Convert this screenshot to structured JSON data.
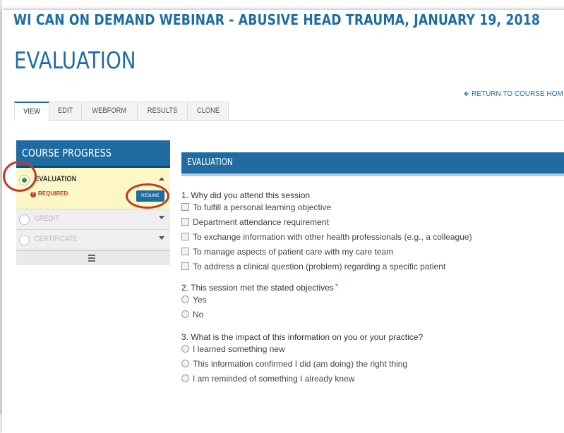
{
  "header": {
    "course_title": "WI CAN ON DEMAND WEBINAR - ABUSIVE HEAD TRAUMA, JANUARY 19, 2018",
    "page_title": "EVALUATION",
    "return_link": "RETURN TO COURSE HOM"
  },
  "tabs": [
    {
      "label": "VIEW",
      "active": true
    },
    {
      "label": "EDIT"
    },
    {
      "label": "WEBFORM"
    },
    {
      "label": "RESULTS"
    },
    {
      "label": "CLONE"
    }
  ],
  "course_progress": {
    "title": "COURSE PROGRESS",
    "steps": [
      {
        "name": "EVALUATION",
        "status": "REQUIRED",
        "action": "RESUME"
      },
      {
        "name": "CREDIT"
      },
      {
        "name": "CERTIFICATE"
      }
    ]
  },
  "evaluation": {
    "header": "EVALUATION",
    "questions": [
      {
        "text": "1. Why did you attend this session",
        "type": "checkbox",
        "options": [
          "To fulfill a personal learning objective",
          "Department attendance requirement",
          "To exchange information with other health professionals (e.g., a colleague)",
          "To manage aspects of patient care with my care team",
          "To address a clinical question (problem) regarding a specific patient"
        ]
      },
      {
        "text": "2. This session met the stated objectives",
        "required_mark": "*",
        "type": "radio",
        "options": [
          "Yes",
          "No"
        ]
      },
      {
        "text": "3. What is the impact of this information on you or your practice?",
        "type": "radio",
        "options": [
          "I learned something new",
          "This information confirmed I did (am doing) the right thing",
          "I am reminded of something I already knew"
        ]
      }
    ]
  },
  "colors": {
    "brand_blue": "#1f6ca3",
    "current_step_bg": "#fcf7c5",
    "required_red": "#c0392b",
    "annotation_circle": "#c0392b"
  },
  "icons": {
    "return": "arrow-left-icon",
    "expand": "caret-down-icon",
    "collapse": "caret-up-icon",
    "menu": "hamburger-icon",
    "required": "exclamation-icon"
  }
}
